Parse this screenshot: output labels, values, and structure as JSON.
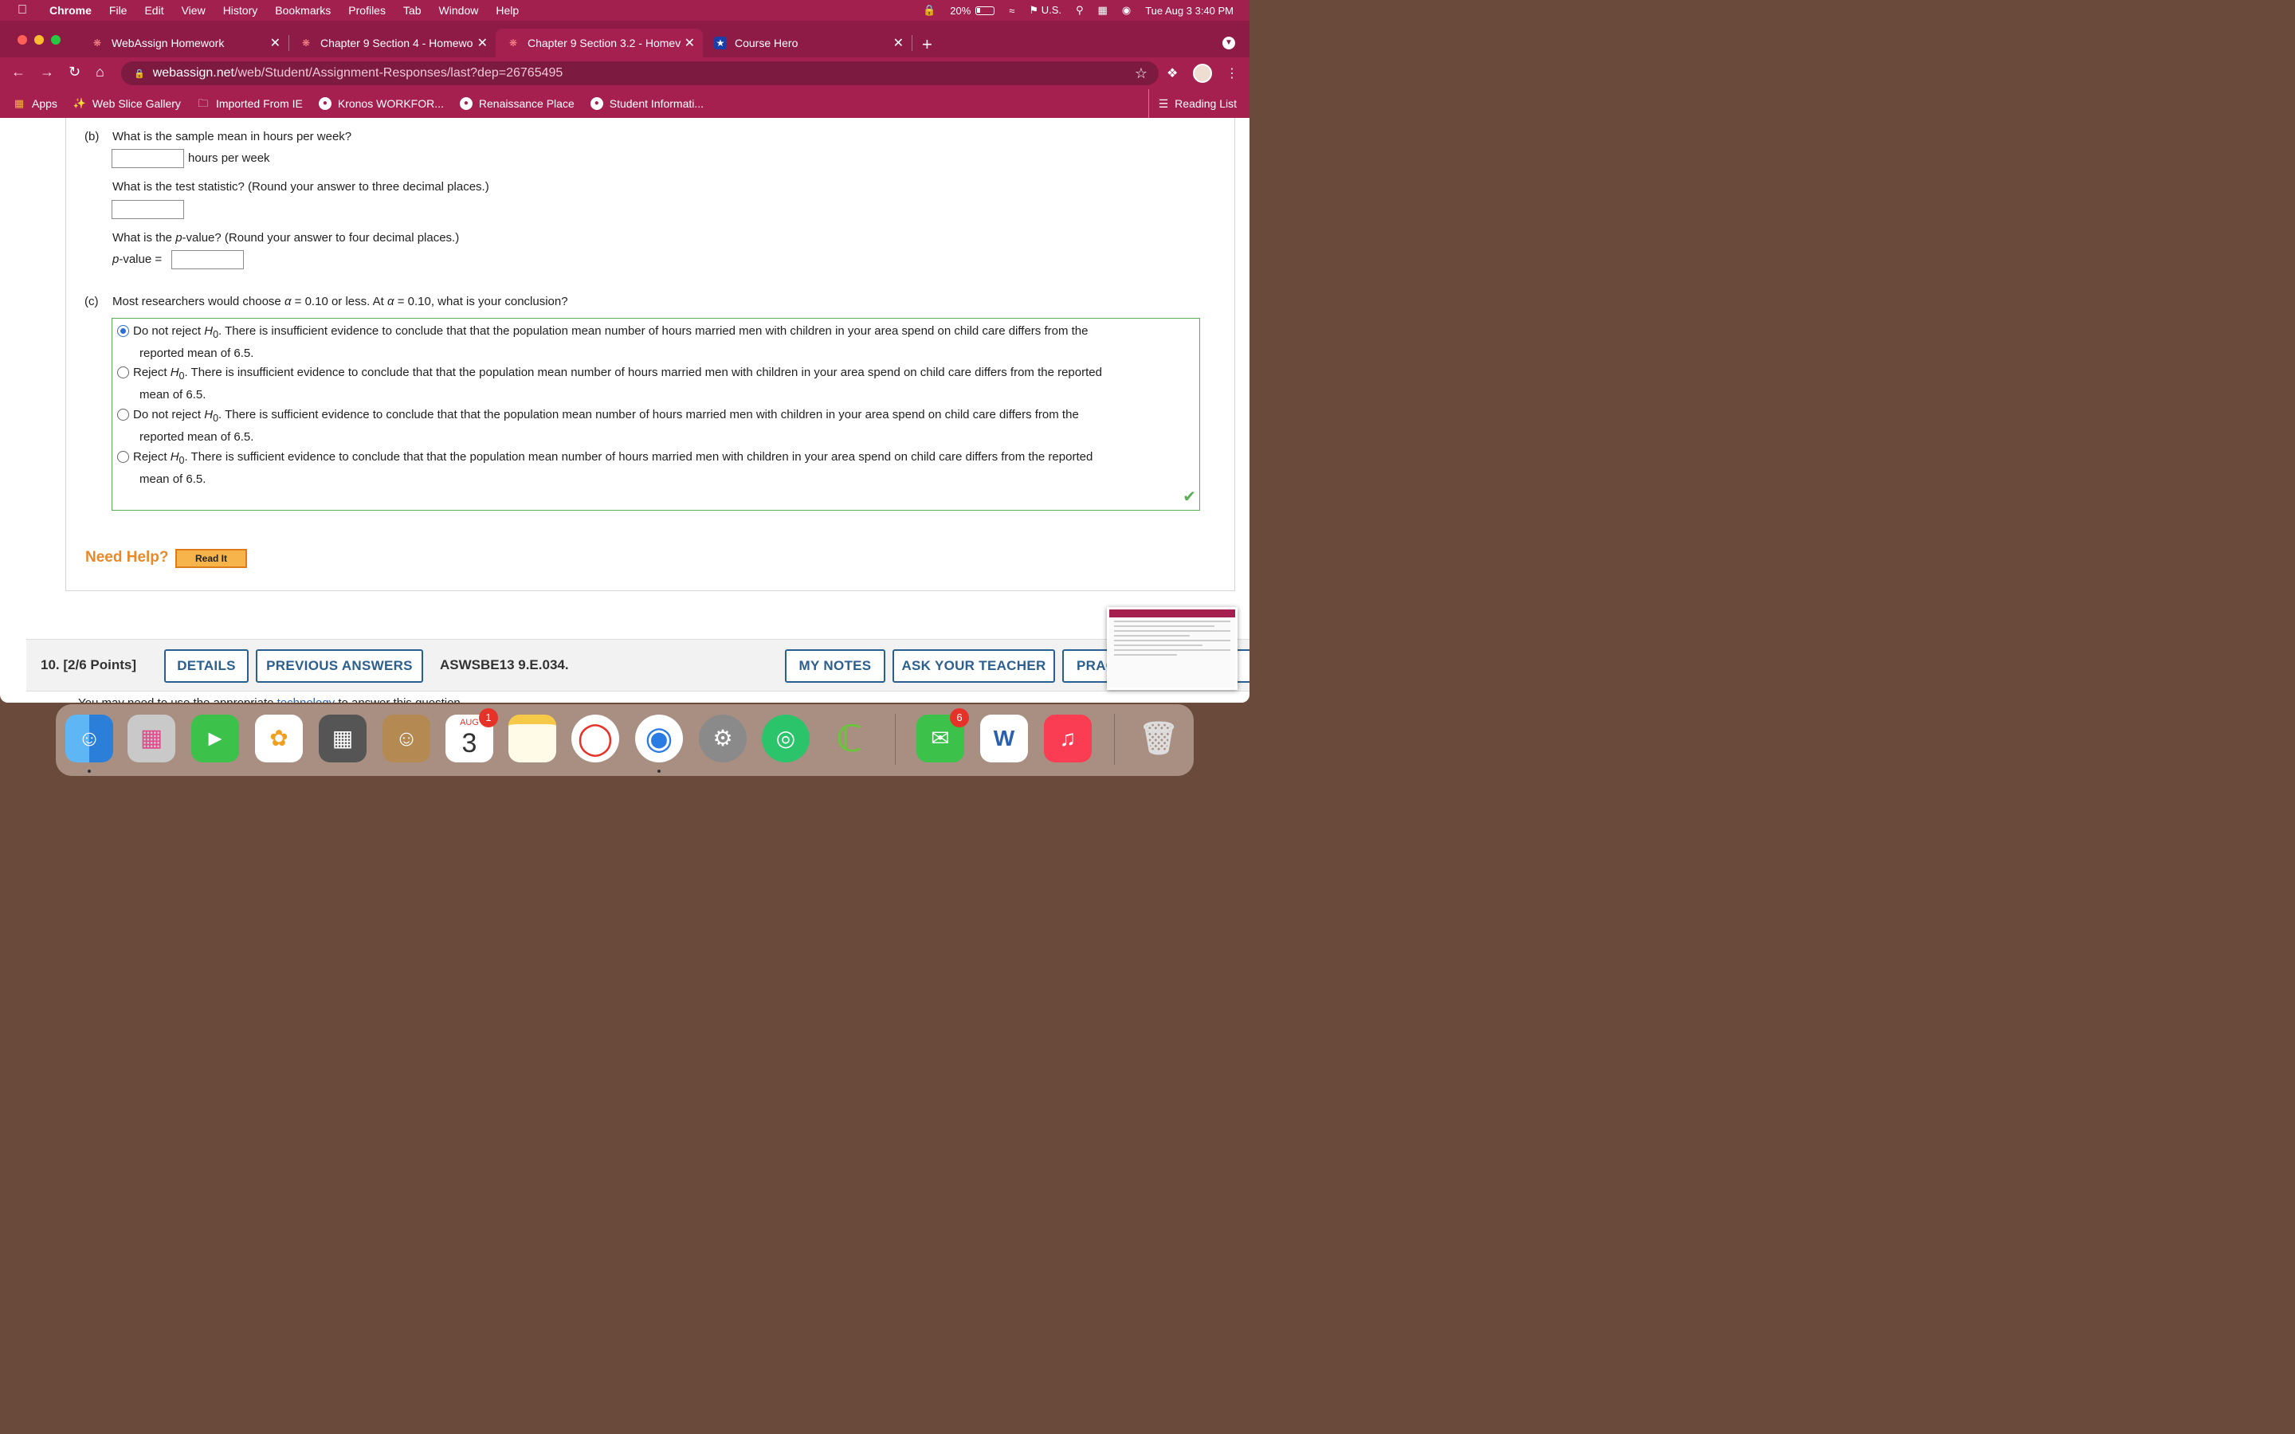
{
  "menubar": {
    "apple": "",
    "items": [
      "Chrome",
      "File",
      "Edit",
      "View",
      "History",
      "Bookmarks",
      "Profiles",
      "Tab",
      "Window",
      "Help"
    ],
    "battery": "20%",
    "input_source": "U.S.",
    "clock": "Tue Aug 3  3:40 PM"
  },
  "tabs": [
    {
      "title": "WebAssign Homework",
      "active": false
    },
    {
      "title": "Chapter 9 Section 4 - Homewo",
      "active": false
    },
    {
      "title": "Chapter 9 Section 3.2 - Homev",
      "active": true
    },
    {
      "title": "Course Hero",
      "active": false
    }
  ],
  "address": {
    "host": "webassign.net",
    "path": "/web/Student/Assignment-Responses/last?dep=26765495"
  },
  "bookmarks": [
    {
      "label": "Apps"
    },
    {
      "label": "Web Slice Gallery"
    },
    {
      "label": "Imported From IE"
    },
    {
      "label": "Kronos WORKFOR..."
    },
    {
      "label": "Renaissance Place"
    },
    {
      "label": "Student Informati..."
    }
  ],
  "reading_list": "Reading List",
  "question": {
    "part_b": {
      "marker": "(b)",
      "q1": "What is the sample mean in hours per week?",
      "q1_unit": "hours per week",
      "q1_value": "",
      "q2": "What is the test statistic? (Round your answer to three decimal places.)",
      "q2_value": "",
      "q3_pre": "What is the ",
      "q3_var": "p",
      "q3_post": "-value? (Round your answer to four decimal places.)",
      "pvalue_var": "p",
      "pvalue_label": "-value =",
      "pvalue_value": ""
    },
    "part_c": {
      "marker": "(c)",
      "prompt_1": "Most researchers would choose ",
      "alpha": "α",
      "prompt_2": " = 0.10 or less. At ",
      "prompt_3": " = 0.10, what is your conclusion?",
      "choices": [
        {
          "lead": "Do not reject ",
          "rest": ". There is insufficient evidence to conclude that that the population mean number of hours married men with children in your area spend on child care differs from the",
          "cont": "reported mean of 6.5.",
          "selected": true
        },
        {
          "lead": "Reject ",
          "rest": ". There is insufficient evidence to conclude that that the population mean number of hours married men with children in your area spend on child care differs from the reported",
          "cont": "mean of 6.5.",
          "selected": false
        },
        {
          "lead": "Do not reject ",
          "rest": ". There is sufficient evidence to conclude that that the population mean number of hours married men with children in your area spend on child care differs from the",
          "cont": "reported mean of 6.5.",
          "selected": false
        },
        {
          "lead": "Reject ",
          "rest": ". There is sufficient evidence to conclude that that the population mean number of hours married men with children in your area spend on child care differs from the reported",
          "cont": "mean of 6.5.",
          "selected": false
        }
      ],
      "h_var": "H",
      "h_sub": "0"
    },
    "need_help": "Need Help?",
    "read_it": "Read It"
  },
  "next_question": {
    "number": "10.  [2/6 Points]",
    "details": "DETAILS",
    "previous_answers": "PREVIOUS ANSWERS",
    "code": "ASWSBE13 9.E.034.",
    "my_notes": "MY NOTES",
    "ask_teacher": "ASK YOUR TEACHER",
    "practice": "PRAC",
    "partial_line_pre": "You may need to use the appropriate ",
    "partial_line_link": "technology",
    "partial_line_post": " to answer this question."
  },
  "dock": {
    "calendar_month": "AUG",
    "calendar_day": "3",
    "calendar_badge": "1",
    "messages_badge": "6",
    "word_letter": "W"
  }
}
